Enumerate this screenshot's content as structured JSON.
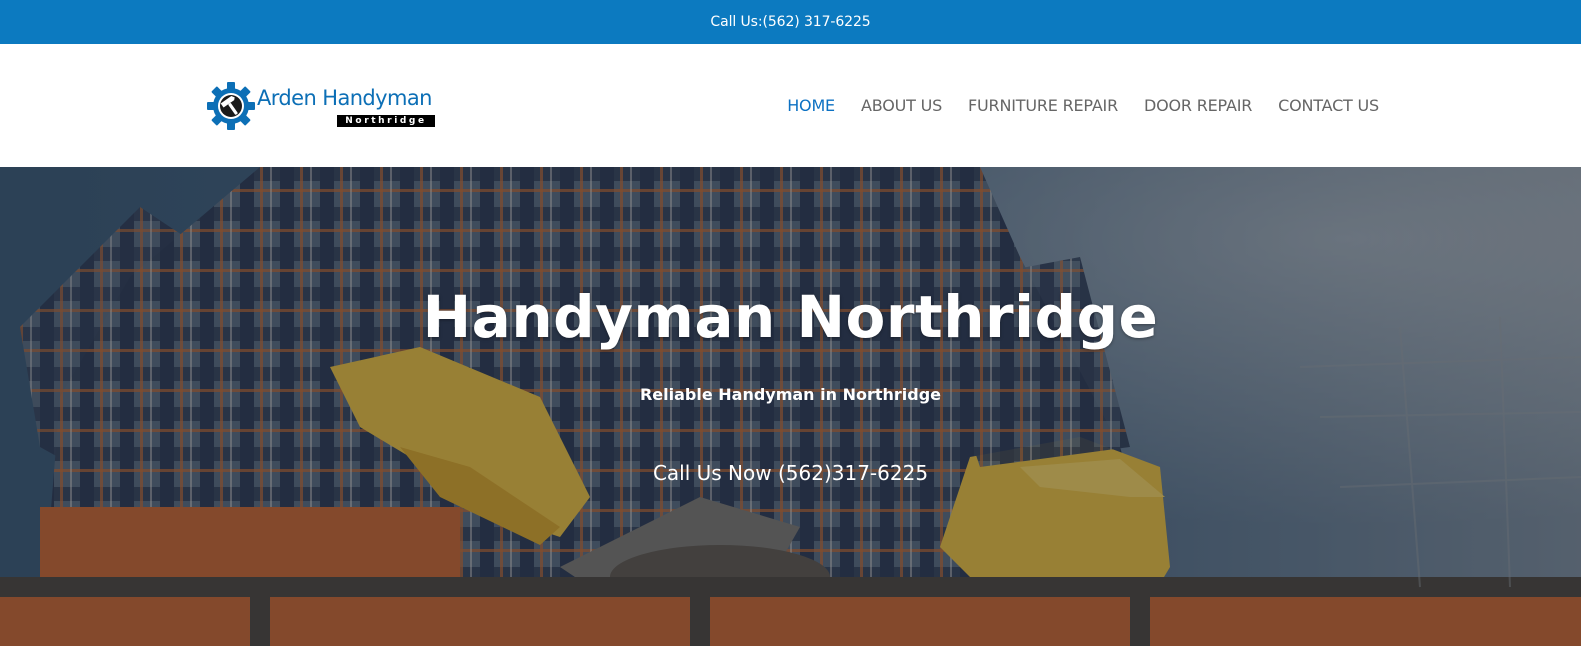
{
  "topbar": {
    "phone_text": "Call Us:(562) 317-6225"
  },
  "header": {
    "logo": {
      "brand": "Arden Handyman",
      "sub": "Northridge",
      "icon": "gear-hammer-icon"
    },
    "nav": [
      {
        "label": "HOME",
        "active": true
      },
      {
        "label": "ABOUT US",
        "active": false
      },
      {
        "label": "FURNITURE REPAIR",
        "active": false
      },
      {
        "label": "DOOR REPAIR",
        "active": false
      },
      {
        "label": "CONTACT US",
        "active": false
      }
    ]
  },
  "hero": {
    "title": "Handyman Northridge",
    "subtitle": "Reliable Handyman in Northridge",
    "cta": "Call Us Now (562)317-6225",
    "image": "worker-laying-bricks-photo"
  },
  "colors": {
    "topbar_bg": "#0C7AC0",
    "nav_active": "#0C71C3",
    "nav_default": "#666666",
    "logo_blue": "#0C6FB6"
  }
}
